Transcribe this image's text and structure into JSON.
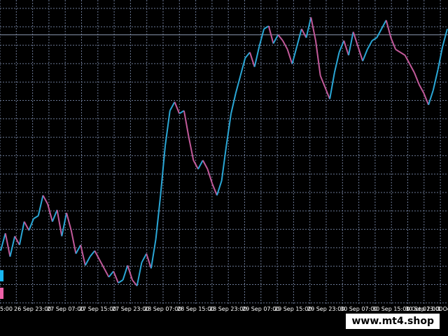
{
  "colors": {
    "background": "#000000",
    "grid": "#6b7894",
    "bull": "#2aa7d6",
    "bear": "#c25a9a",
    "level_line": "#8a97b0",
    "axis_text": "#ffffff",
    "legend_bull": "#19b6f0",
    "legend_bear": "#ee62a8"
  },
  "time_axis": {
    "labels": [
      "5:00",
      "26 Sep 23:00",
      "27 Sep 07:00",
      "27 Sep 15:00",
      "27 Sep 23:00",
      "28 Sep 07:00",
      "28 Sep 15:00",
      "28 Sep 23:00",
      "29 Sep 07:00",
      "29 Sep 15:00",
      "29 Sep 23:00",
      "30 Sep 07:00",
      "30 Sep 15:00",
      "30 Sep 23:00",
      "1 Oct 07:00",
      "1 Oc"
    ]
  },
  "watermark": "www.mt4.shop",
  "legend": {
    "icons": [
      "bull-color-swatch",
      "bear-color-swatch"
    ]
  },
  "chart_data": {
    "type": "line",
    "ylim": [
      0,
      100
    ],
    "grid": true,
    "horizontal_level": 90,
    "series": [
      {
        "x": [
          0,
          1,
          2,
          3,
          4,
          5,
          6,
          7,
          8,
          9,
          10,
          11,
          12,
          13,
          14,
          15,
          16,
          17,
          18,
          19,
          20,
          21,
          22,
          23,
          24,
          25,
          26,
          27,
          28,
          29,
          30,
          31,
          32,
          33,
          34,
          35,
          36,
          37,
          38,
          39,
          40,
          41,
          42,
          43,
          44,
          45,
          46,
          47,
          48,
          49,
          50,
          51,
          52,
          53,
          54,
          55,
          56,
          57,
          58,
          59,
          60,
          61,
          62,
          63,
          64,
          65,
          66,
          67,
          68,
          69,
          70,
          71,
          72,
          73,
          74,
          75,
          76,
          77,
          78,
          79,
          80,
          81,
          82,
          83,
          84,
          85,
          86,
          87,
          88,
          89,
          90,
          91,
          92,
          93,
          94,
          95
        ],
        "values": [
          16,
          22,
          14,
          21,
          18,
          26,
          23,
          27,
          28,
          35,
          32,
          26,
          30,
          21,
          29,
          23,
          15,
          18,
          11,
          14,
          16,
          13,
          10,
          7,
          9,
          5,
          6,
          11,
          6,
          4,
          12,
          15,
          10,
          20,
          35,
          52,
          64,
          67,
          63,
          64,
          55,
          47,
          44,
          47,
          44,
          39,
          35,
          40,
          52,
          63,
          70,
          76,
          82,
          84,
          79,
          86,
          92,
          93,
          87,
          90,
          88,
          85,
          80,
          86,
          92,
          89,
          96,
          88,
          76,
          72,
          68,
          77,
          84,
          88,
          83,
          91,
          86,
          81,
          85,
          88,
          89,
          92,
          95,
          89,
          85,
          84,
          83,
          80,
          77,
          73,
          70,
          66,
          71,
          78,
          86,
          92
        ]
      }
    ]
  }
}
